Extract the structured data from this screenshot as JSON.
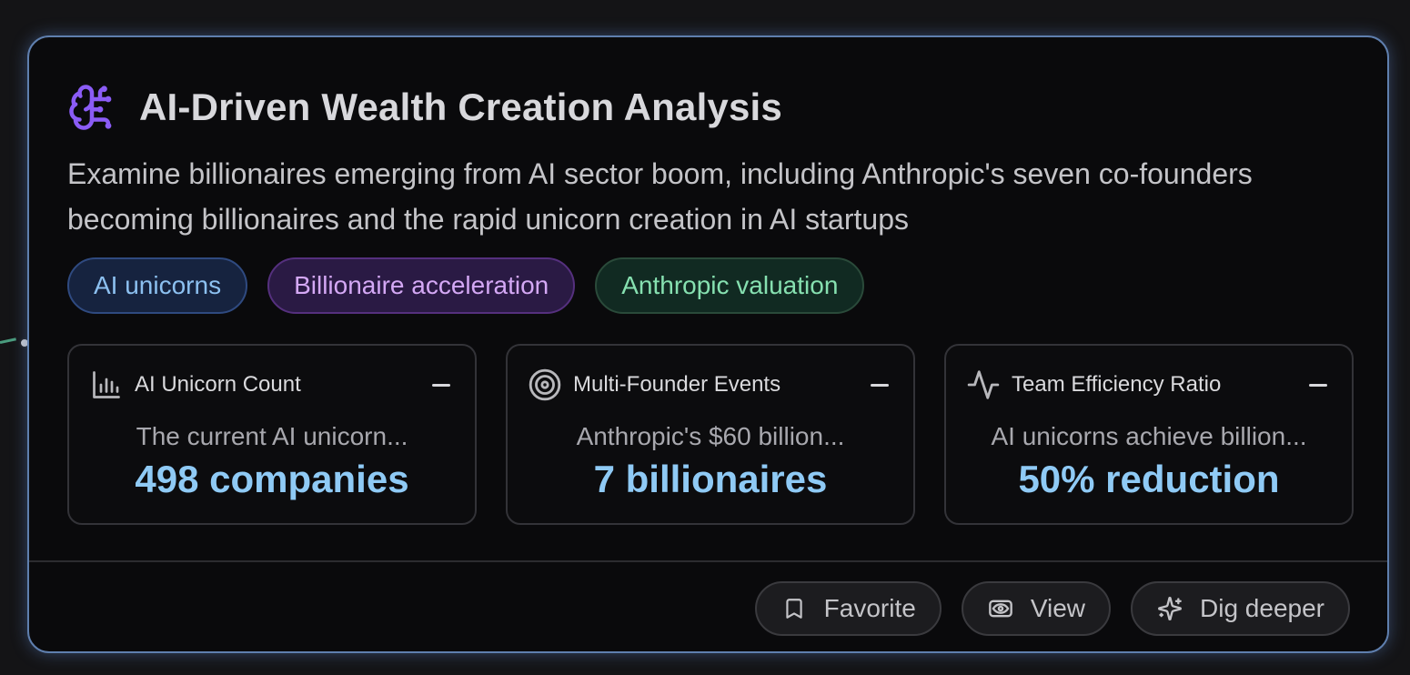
{
  "card": {
    "title": "AI-Driven Wealth Creation Analysis",
    "description": "Examine billionaires emerging from AI sector boom, including Anthropic's seven co-founders becoming billionaires and the rapid unicorn creation in AI startups",
    "icon": "brain-icon",
    "accent_color": "#8b5cf6"
  },
  "tags": [
    {
      "label": "AI unicorns",
      "color": "#8cc0f0"
    },
    {
      "label": "Billionaire acceleration",
      "color": "#d4a8f5"
    },
    {
      "label": "Anthropic valuation",
      "color": "#86e0b0"
    }
  ],
  "metrics": [
    {
      "icon": "bar-chart-icon",
      "label": "AI Unicorn Count",
      "description": "The current AI unicorn...",
      "value": "498 companies"
    },
    {
      "icon": "target-icon",
      "label": "Multi-Founder Events",
      "description": "Anthropic's $60 billion...",
      "value": "7 billionaires"
    },
    {
      "icon": "activity-icon",
      "label": "Team Efficiency Ratio",
      "description": "AI unicorns achieve billion...",
      "value": "50% reduction"
    }
  ],
  "actions": {
    "favorite_label": "Favorite",
    "view_label": "View",
    "dig_deeper_label": "Dig deeper"
  },
  "colors": {
    "value_text": "#8fcaf5",
    "card_border": "#5f7fae"
  }
}
